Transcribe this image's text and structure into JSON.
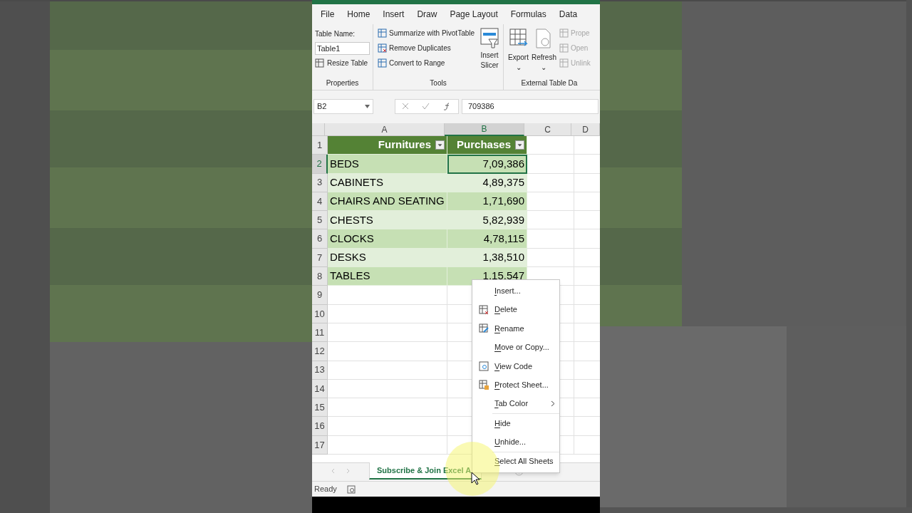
{
  "ribbon": {
    "tabs": [
      "File",
      "Home",
      "Insert",
      "Draw",
      "Page Layout",
      "Formulas",
      "Data"
    ],
    "groups": [
      {
        "kind": "properties",
        "label": "Properties",
        "field_label": "Table Name:",
        "field_value": "Table1",
        "command": "Resize Table"
      },
      {
        "kind": "tools",
        "label": "Tools",
        "commands": [
          "Summarize with PivotTable",
          "Remove Duplicates",
          "Convert to Range"
        ],
        "big_command": [
          "Insert",
          "Slicer"
        ]
      },
      {
        "kind": "external",
        "label": "External Table Da",
        "big_commands": [
          {
            "label": "Export",
            "caret": "⌄"
          },
          {
            "label": "Refresh",
            "caret": "⌄"
          }
        ],
        "small_commands": [
          {
            "label": "Prope",
            "disabled": true
          },
          {
            "label": "Open",
            "disabled": true
          },
          {
            "label": "Unlink",
            "disabled": true
          }
        ]
      }
    ]
  },
  "formula_bar": {
    "name_box": "B2",
    "value": "709386"
  },
  "sheet": {
    "columns": [
      {
        "label": "A",
        "selected": false
      },
      {
        "label": "B",
        "selected": true
      },
      {
        "label": "C",
        "selected": false
      },
      {
        "label": "D",
        "selected": false
      }
    ],
    "rows": [
      {
        "number": "1",
        "kind": "header",
        "selected": false,
        "cells": [
          "Furnitures",
          "Purchases"
        ]
      },
      {
        "number": "2",
        "kind": "data",
        "selected": true,
        "cells": [
          "BEDS",
          "7,09,386"
        ]
      },
      {
        "number": "3",
        "kind": "data",
        "selected": false,
        "cells": [
          "CABINETS",
          "4,89,375"
        ]
      },
      {
        "number": "4",
        "kind": "data",
        "selected": false,
        "cells": [
          "CHAIRS AND SEATING",
          "1,71,690"
        ]
      },
      {
        "number": "5",
        "kind": "data",
        "selected": false,
        "cells": [
          "CHESTS",
          "5,82,939"
        ]
      },
      {
        "number": "6",
        "kind": "data",
        "selected": false,
        "cells": [
          "CLOCKS",
          "4,78,115"
        ]
      },
      {
        "number": "7",
        "kind": "data",
        "selected": false,
        "cells": [
          "DESKS",
          "1,38,510"
        ]
      },
      {
        "number": "8",
        "kind": "data",
        "selected": false,
        "cells": [
          "TABLES",
          "1,15,547"
        ]
      },
      {
        "number": "9",
        "kind": "empty",
        "selected": false
      },
      {
        "number": "10",
        "kind": "empty",
        "selected": false
      },
      {
        "number": "11",
        "kind": "empty",
        "selected": false
      },
      {
        "number": "12",
        "kind": "empty",
        "selected": false
      },
      {
        "number": "13",
        "kind": "empty",
        "selected": false
      },
      {
        "number": "14",
        "kind": "empty",
        "selected": false
      },
      {
        "number": "15",
        "kind": "empty",
        "selected": false
      },
      {
        "number": "16",
        "kind": "empty",
        "selected": false
      },
      {
        "number": "17",
        "kind": "empty",
        "selected": false
      }
    ]
  },
  "context_menu": {
    "groups": [
      [
        {
          "label": "Insert...",
          "kind": "plain"
        },
        {
          "label": "Delete",
          "kind": "delete"
        },
        {
          "label": "Rename",
          "kind": "rename"
        },
        {
          "label": "Move or Copy...",
          "kind": "plain"
        },
        {
          "label": "View Code",
          "kind": "code"
        },
        {
          "label": "Protect Sheet...",
          "kind": "protect"
        },
        {
          "label": "Tab Color",
          "kind": "submenu"
        }
      ],
      [
        {
          "label": "Hide",
          "kind": "plain"
        },
        {
          "label": "Unhide...",
          "kind": "plain"
        }
      ],
      [
        {
          "label": "Select All Sheets",
          "kind": "plain"
        }
      ]
    ]
  },
  "sheet_tabs": [
    {
      "label": "Subscribe & Join Excel A",
      "selected": true
    }
  ],
  "status_bar": {
    "text": "Ready"
  }
}
